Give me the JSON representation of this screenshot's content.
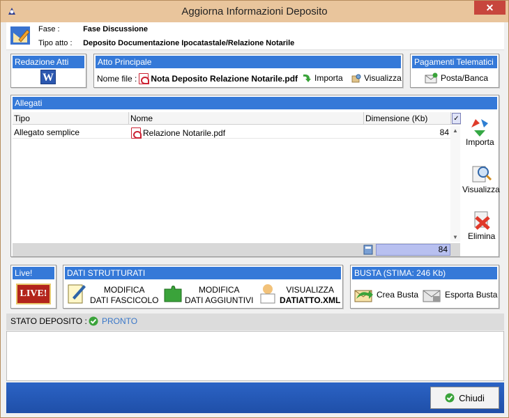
{
  "window": {
    "title": "Aggiorna Informazioni Deposito",
    "close_label": "✕"
  },
  "info": {
    "fase_label": "Fase :",
    "fase_value": "Fase Discussione",
    "tipo_label": "Tipo atto :",
    "tipo_value": "Deposito Documentazione Ipocatastale/Relazione Notarile"
  },
  "redazione": {
    "title": "Redazione Atti",
    "word_letter": "W"
  },
  "atto": {
    "title": "Atto Principale",
    "file_label": "Nome file :",
    "file_name": "Nota Deposito Relazione Notarile.pdf",
    "importa": "Importa",
    "visualizza": "Visualizza"
  },
  "pagamenti": {
    "title": "Pagamenti Telematici",
    "posta": "Posta/Banca"
  },
  "allegati": {
    "title": "Allegati",
    "columns": [
      "Tipo",
      "Nome",
      "Dimensione (Kb)"
    ],
    "rows": [
      {
        "tipo": "Allegato semplice",
        "nome": "Relazione Notarile.pdf",
        "dim": "84"
      }
    ],
    "total": "84",
    "actions": {
      "importa": "Importa",
      "visualizza": "Visualizza",
      "elimina": "Elimina"
    }
  },
  "live": {
    "title": "Live!",
    "badge": "LIVE!"
  },
  "dati": {
    "title": "DATI STRUTTURATI",
    "mod_fasc_1": "MODIFICA",
    "mod_fasc_2": "DATI FASCICOLO",
    "mod_agg_1": "MODIFICA",
    "mod_agg_2": "DATI AGGIUNTIVI",
    "vis_1": "VISUALIZZA",
    "vis_2": "DATIATTO.XML"
  },
  "busta": {
    "title": "BUSTA (STIMA: 246 Kb)",
    "crea": "Crea Busta",
    "esporta": "Esporta Busta"
  },
  "stato": {
    "label": "STATO DEPOSITO :",
    "value": "PRONTO"
  },
  "footer": {
    "chiudi": "Chiudi"
  }
}
